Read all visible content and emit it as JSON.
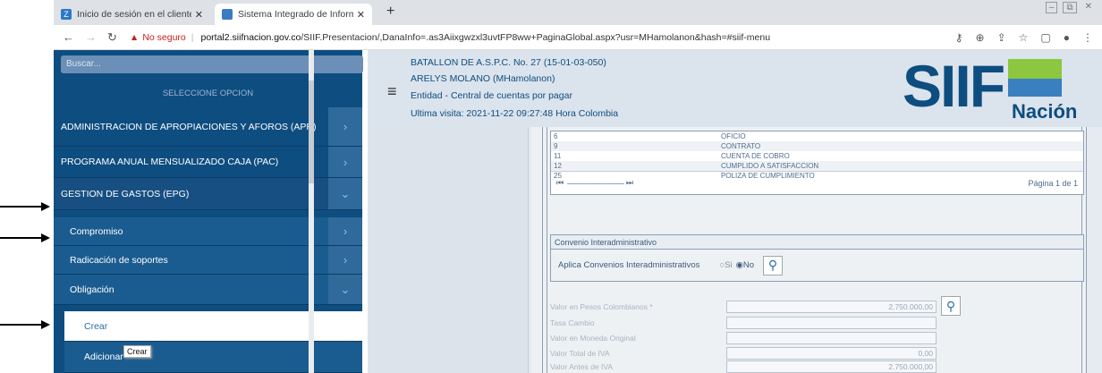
{
  "browser": {
    "tabs": [
      {
        "title": "Inicio de sesión en el cliente web"
      },
      {
        "title": "Sistema Integrado de Información"
      }
    ],
    "warning": "No seguro",
    "url_host": "portal2.siifnacion.gov.co",
    "url_path": "/SIIF.Presentacion/,DanaInfo=.as3Aiixgwzxl3uvtFP8ww+PaginaGlobal.aspx?usr=MHamolanon&hash=#siif-menu"
  },
  "sidebar": {
    "search_placeholder": "Buscar...",
    "section_header": "SELECCIONE OPCION",
    "items": [
      {
        "label": "ADMINISTRACION DE APROPIACIONES Y AFOROS (APR)"
      },
      {
        "label": "PROGRAMA ANUAL MENSUALIZADO CAJA (PAC)"
      },
      {
        "label": "GESTION DE GASTOS (EPG)"
      },
      {
        "label": "Compromiso"
      },
      {
        "label": "Radicación de soportes"
      },
      {
        "label": "Obligación"
      },
      {
        "label": "Crear"
      },
      {
        "label": "Adicionar"
      }
    ],
    "tooltip": "Crear"
  },
  "header": {
    "line1": "BATALLON DE A.S.P.C. No. 27 (15-01-03-050)",
    "line2": "ARELYS MOLANO (MHamolanon)",
    "line3": "Entidad - Central de cuentas por pagar",
    "line4": "Ultima visita: 2021-11-22 09:27:48 Hora Colombia",
    "logo_text": "SIIF",
    "logo_sub": "Nación"
  },
  "grid": {
    "rows": [
      {
        "code": "6",
        "name": "OFICIO"
      },
      {
        "code": "9",
        "name": "CONTRATO"
      },
      {
        "code": "11",
        "name": "CUENTA DE COBRO"
      },
      {
        "code": "12",
        "name": "CUMPLIDO A SATISFACCION"
      },
      {
        "code": "25",
        "name": "POLIZA DE CUMPLIMIENTO"
      }
    ],
    "page_label": "Página 1 de 1"
  },
  "convenio": {
    "title": "Convenio Interadministrativo",
    "label": "Aplica Convenios Interadministrativos",
    "opt_si": "Si",
    "opt_no": "No"
  },
  "form": {
    "fields": [
      {
        "label": "Valor en Pesos Colombianos *",
        "value": "2.750.000,00"
      },
      {
        "label": "Tasa Cambio",
        "value": ""
      },
      {
        "label": "Valor en Moneda Original",
        "value": ""
      },
      {
        "label": "Valor Total de IVA",
        "value": "0,00"
      },
      {
        "label": "Valor Antes de IVA",
        "value": "2.750.000,00"
      }
    ]
  },
  "colors": {
    "sidebar_bg": "#0e4d80",
    "accent": "#2a6fa9",
    "header_bg": "#dbe3ec"
  }
}
